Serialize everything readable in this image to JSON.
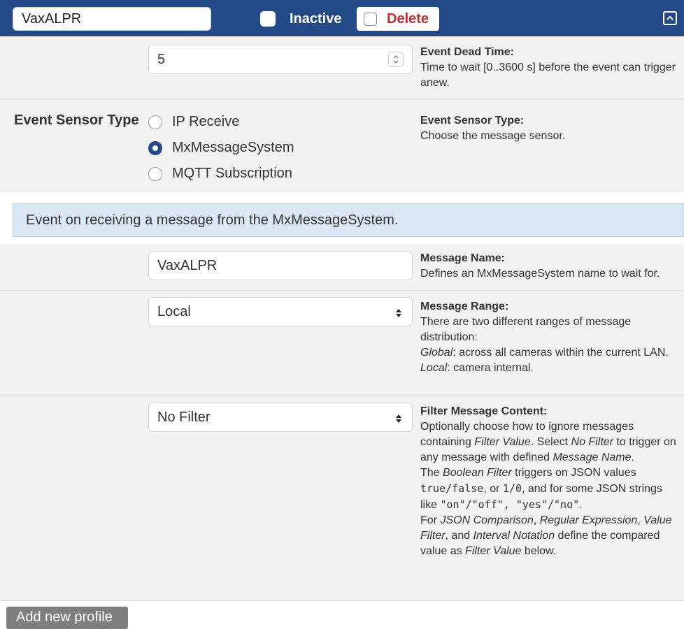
{
  "header": {
    "profile_name": "VaxALPR",
    "inactive_label": "Inactive",
    "delete_label": "Delete"
  },
  "dead_time": {
    "value": "5",
    "help_title": "Event Dead Time",
    "help_text": "Time to wait [0..3600 s] before the event can trigger anew."
  },
  "sensor": {
    "label": "Event Sensor Type",
    "options": [
      {
        "label": "IP Receive",
        "checked": false
      },
      {
        "label": "MxMessageSystem",
        "checked": true
      },
      {
        "label": "MQTT Subscription",
        "checked": false
      }
    ],
    "help_title": "Event Sensor Type",
    "help_text": "Choose the message sensor."
  },
  "info_banner": "Event on receiving a message from the MxMessageSystem.",
  "message_name": {
    "value": "VaxALPR",
    "help_title": "Message Name",
    "help_text": "Defines an MxMessageSystem name to wait for."
  },
  "message_range": {
    "value": "Local",
    "help_title": "Message Range",
    "help_line1": "There are two different ranges of message distribution:",
    "global_term": "Global",
    "global_text": ": across all cameras within the current LAN.",
    "local_term": "Local",
    "local_text": ": camera internal."
  },
  "filter": {
    "value": "No Filter",
    "help_title": "Filter Message Content",
    "t1": "Optionally choose how to ignore messages containing ",
    "t1_i": "Filter Value",
    "t2": ". Select ",
    "t2_i": "No Filter",
    "t3": " to trigger on any message with defined ",
    "t3_i": "Message Name",
    "t4": ".",
    "t5": "The ",
    "t5_i": "Boolean Filter",
    "t6": " triggers on JSON values ",
    "c_true": "true",
    "c_sep1": "/",
    "c_false": "false",
    "t7": ", or ",
    "c_1": "1",
    "c_sep2": "/",
    "c_0": "0",
    "t8": ", and for some JSON strings like ",
    "c_on": "\"on\"",
    "c_sep3": "/",
    "c_off": "\"off\"",
    "c_comma": ", ",
    "c_yes": "\"yes\"",
    "c_sep4": "/",
    "c_no": "\"no\"",
    "t9": ".",
    "t10": "For ",
    "t10_i": "JSON Comparison",
    "t11": ", ",
    "t11_i": "Regular Expression",
    "t12": ", ",
    "t12_i": "Value Filter",
    "t13": ", and ",
    "t13_i": "Interval Notation",
    "t14": " define the compared value as ",
    "t14_i": "Filter Value",
    "t15": " below."
  },
  "footer": {
    "add_label": "Add new profile"
  },
  "colors": {
    "header_bg": "#234a86",
    "delete_red": "#c52d2f",
    "row_bg": "#f2f2f2",
    "info_bg": "#dbe7f5",
    "button_gray": "#7e7e7e"
  },
  "icons": [
    "collapse-icon",
    "spinner-arrows-icon",
    "select-updown-icon"
  ]
}
